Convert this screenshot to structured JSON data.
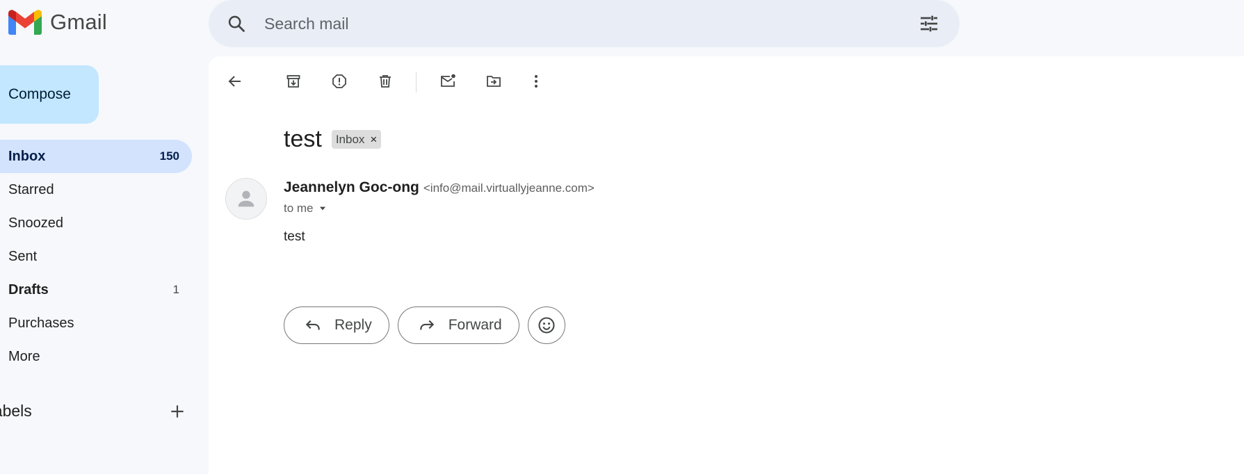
{
  "app": {
    "name": "Gmail"
  },
  "search": {
    "placeholder": "Search mail"
  },
  "compose": {
    "label": "Compose"
  },
  "nav": [
    {
      "label": "Inbox",
      "count": "150"
    },
    {
      "label": "Starred",
      "count": ""
    },
    {
      "label": "Snoozed",
      "count": ""
    },
    {
      "label": "Sent",
      "count": ""
    },
    {
      "label": "Drafts",
      "count": "1"
    },
    {
      "label": "Purchases",
      "count": ""
    },
    {
      "label": "More",
      "count": ""
    }
  ],
  "labels_section": {
    "title": "Labels"
  },
  "toolbar": {
    "icons": [
      "back-arrow-icon",
      "archive-icon",
      "report-spam-icon",
      "delete-icon",
      "mark-unread-icon",
      "move-to-icon",
      "more-vert-icon"
    ]
  },
  "message": {
    "subject": "test",
    "label_chip": "Inbox",
    "chip_close": "×",
    "sender_name": "Jeannelyn Goc-ong",
    "sender_email": "<info@mail.virtuallyjeanne.com>",
    "to": "to me",
    "body": "test"
  },
  "actions": {
    "reply": "Reply",
    "forward": "Forward"
  },
  "colors": {
    "background": "#f6f8fc",
    "search_bg": "#e9eef6",
    "compose_bg": "#c2e7ff",
    "active_nav_bg": "#d3e3fd",
    "panel_bg": "#ffffff"
  }
}
